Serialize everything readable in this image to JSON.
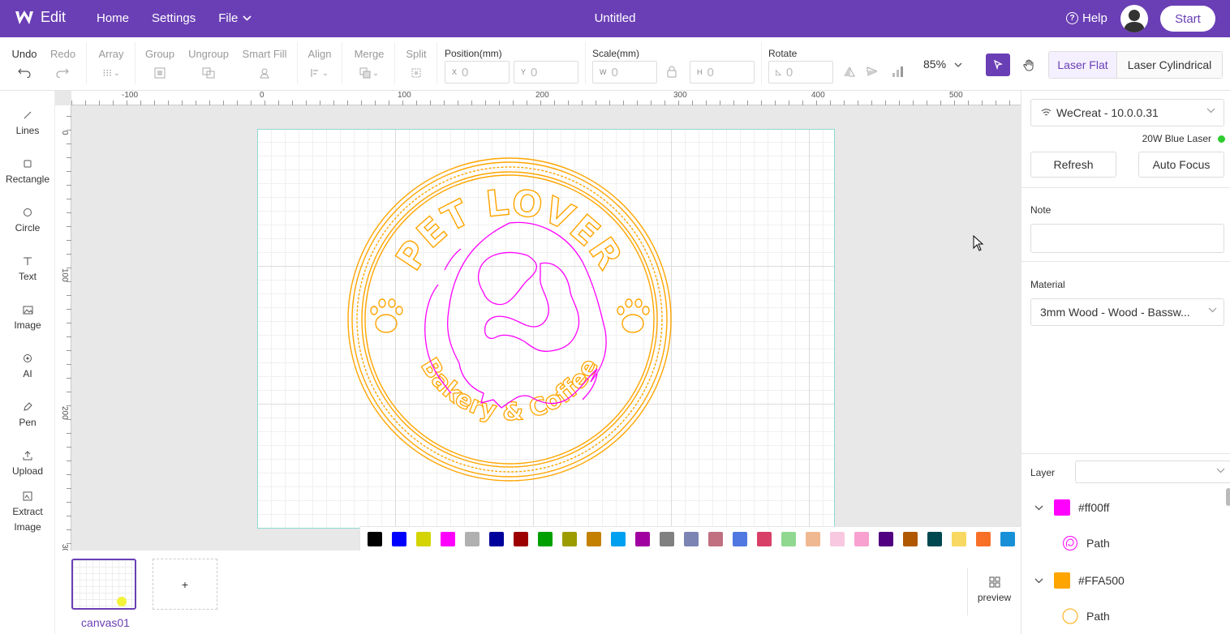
{
  "header": {
    "app_label": "Edit",
    "nav": [
      "Home",
      "Settings",
      "File"
    ],
    "title": "Untitled",
    "help": "Help",
    "start": "Start"
  },
  "toolbar": {
    "undo": "Undo",
    "redo": "Redo",
    "array": "Array",
    "group": "Group",
    "ungroup": "Ungroup",
    "smart_fill": "Smart Fill",
    "align": "Align",
    "merge": "Merge",
    "split": "Split",
    "position_label": "Position(mm)",
    "pos_x_prefix": "X",
    "pos_x": "0",
    "pos_y_prefix": "Y",
    "pos_y": "0",
    "scale_label": "Scale(mm)",
    "scale_w_prefix": "W",
    "scale_w": "0",
    "scale_h_prefix": "H",
    "scale_h": "0",
    "rotate_label": "Rotate",
    "rotate_value": "0",
    "zoom": "85%",
    "laser_flat": "Laser Flat",
    "laser_cylindrical": "Laser Cylindrical"
  },
  "left_tools": [
    "Lines",
    "Rectangle",
    "Circle",
    "Text",
    "Image",
    "AI",
    "Pen",
    "Upload",
    "Extract",
    "Image"
  ],
  "rulers": {
    "h_labels": [
      "-100",
      "0",
      "100",
      "200",
      "300",
      "400",
      "500"
    ],
    "v_labels": [
      "0",
      "100",
      "200",
      "30"
    ]
  },
  "design": {
    "top_text": "PET LOVER",
    "bottom_text": "Bakery & Coffee",
    "color_outline": "#FFA500",
    "color_dog": "#ff00ff"
  },
  "palette": [
    "#000000",
    "#0000ff",
    "#d4d400",
    "#ff00ff",
    "#b0b0b0",
    "#00009c",
    "#9c0000",
    "#00a000",
    "#9c9c00",
    "#c48000",
    "#00a0f0",
    "#a000a0",
    "#808080",
    "#7c84b4",
    "#c07080",
    "#5078e0",
    "#d84068",
    "#90d890",
    "#f0b890",
    "#f8c8e0",
    "#f8a0d0",
    "#500080",
    "#b05800",
    "#004850",
    "#f8d860",
    "#f87028",
    "#1890d8"
  ],
  "canvases": {
    "items": [
      {
        "label": "canvas01"
      }
    ],
    "add": "+",
    "preview": "preview"
  },
  "right_panel": {
    "device": "WeCreat - 10.0.0.31",
    "laser": "20W Blue Laser",
    "refresh": "Refresh",
    "auto_focus": "Auto Focus",
    "note_label": "Note",
    "note_value": "",
    "material_label": "Material",
    "material_value": "3mm Wood - Wood - Bassw...",
    "layer_label": "Layer",
    "layers": [
      {
        "color": "#ff00ff",
        "name": "#ff00ff",
        "path": "Path"
      },
      {
        "color": "#FFA500",
        "name": "#FFA500",
        "path": "Path"
      }
    ]
  }
}
